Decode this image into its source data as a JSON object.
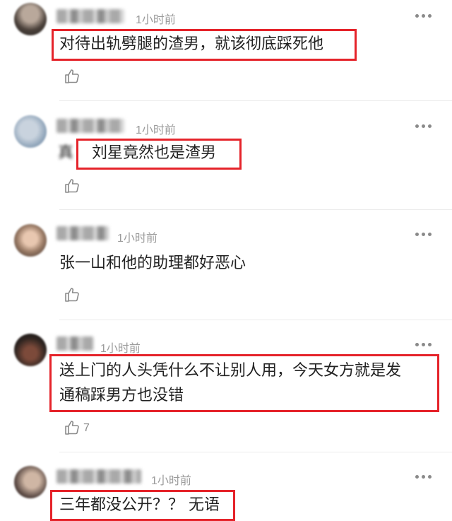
{
  "comments": [
    {
      "time": "1小时前",
      "lines": [
        "对待出轨劈腿的渣男，就该彻底踩死他"
      ],
      "likes": ""
    },
    {
      "time": "1小时前",
      "lines": [
        "刘星竟然也是渣男"
      ],
      "prefix": "真",
      "likes": ""
    },
    {
      "time": "1小时前",
      "lines": [
        "张一山和他的助理都好恶心"
      ],
      "likes": ""
    },
    {
      "time": "1小时前",
      "lines": [
        "送上门的人头凭什么不让别人用，今天女方就是发",
        "通稿踩男方也没错"
      ],
      "likes": "7"
    },
    {
      "time": "1小时前",
      "lines": [
        "三年都没公开？？ 无语"
      ],
      "likes": ""
    }
  ],
  "icons": {
    "like": "thumbs-up-icon",
    "more": "more-horizontal-icon"
  },
  "colors": {
    "highlight_box": "#e5232a",
    "timestamp": "#9b9b9b"
  }
}
